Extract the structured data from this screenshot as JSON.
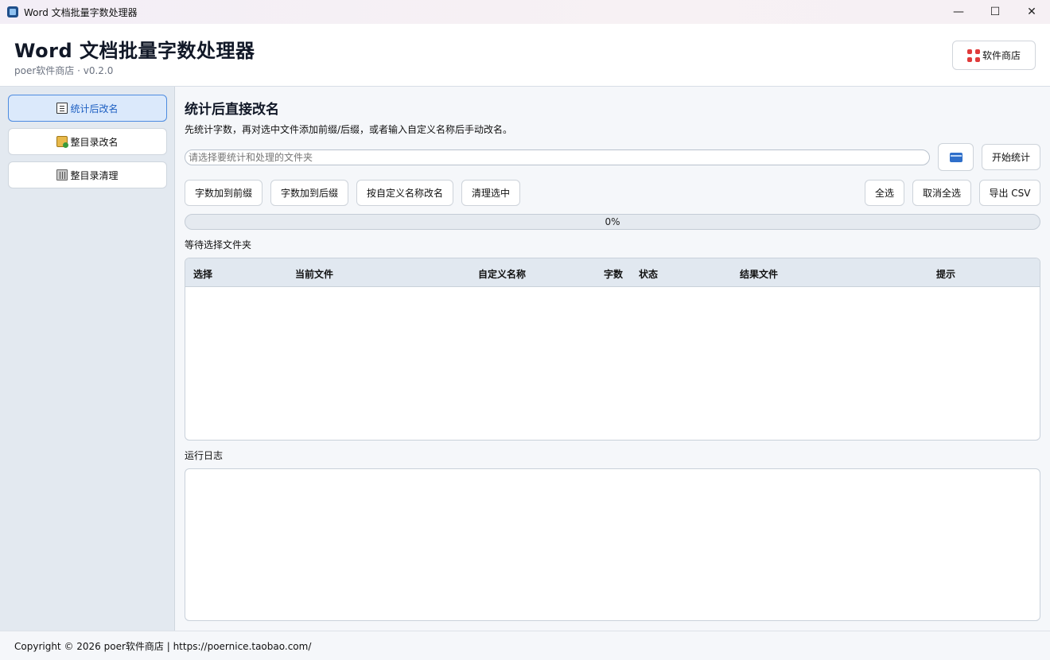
{
  "window": {
    "title": "Word 文档批量字数处理器",
    "controls": {
      "minimize": "—",
      "maximize": "☐",
      "close": "✕"
    }
  },
  "header": {
    "title": "Word 文档批量字数处理器",
    "subtitle": "poer软件商店 · v0.2.0",
    "store_button": "软件商店"
  },
  "sidebar": {
    "items": [
      {
        "label": "统计后改名",
        "icon": "document-icon",
        "active": true
      },
      {
        "label": "整目录改名",
        "icon": "folder-icon",
        "active": false
      },
      {
        "label": "整目录清理",
        "icon": "trash-icon",
        "active": false
      }
    ]
  },
  "main": {
    "title": "统计后直接改名",
    "description": "先统计字数，再对选中文件添加前缀/后缀，或者输入自定义名称后手动改名。",
    "folder_input": {
      "value": "",
      "placeholder": "请选择要统计和处理的文件夹"
    },
    "start_button": "开始统计",
    "actions": {
      "prefix": "字数加到前缀",
      "suffix": "字数加到后缀",
      "custom_rename": "按自定义名称改名",
      "clean_selected": "清理选中",
      "select_all": "全选",
      "deselect_all": "取消全选",
      "export_csv": "导出 CSV"
    },
    "progress": {
      "value": 0,
      "label": "0%"
    },
    "status": "等待选择文件夹",
    "table": {
      "columns": [
        "选择",
        "当前文件",
        "自定义名称",
        "字数",
        "状态",
        "结果文件",
        "提示"
      ],
      "rows": []
    },
    "log": {
      "label": "运行日志",
      "content": ""
    }
  },
  "footer": {
    "copyright": "Copyright © 2026 poer软件商店 | https://poernice.taobao.com/"
  },
  "colors": {
    "sidebar_bg": "#e3e9f0",
    "active_nav_bg": "#dbe9fb",
    "active_nav_border": "#4d8be0",
    "table_header_bg": "#e1e8f0"
  }
}
